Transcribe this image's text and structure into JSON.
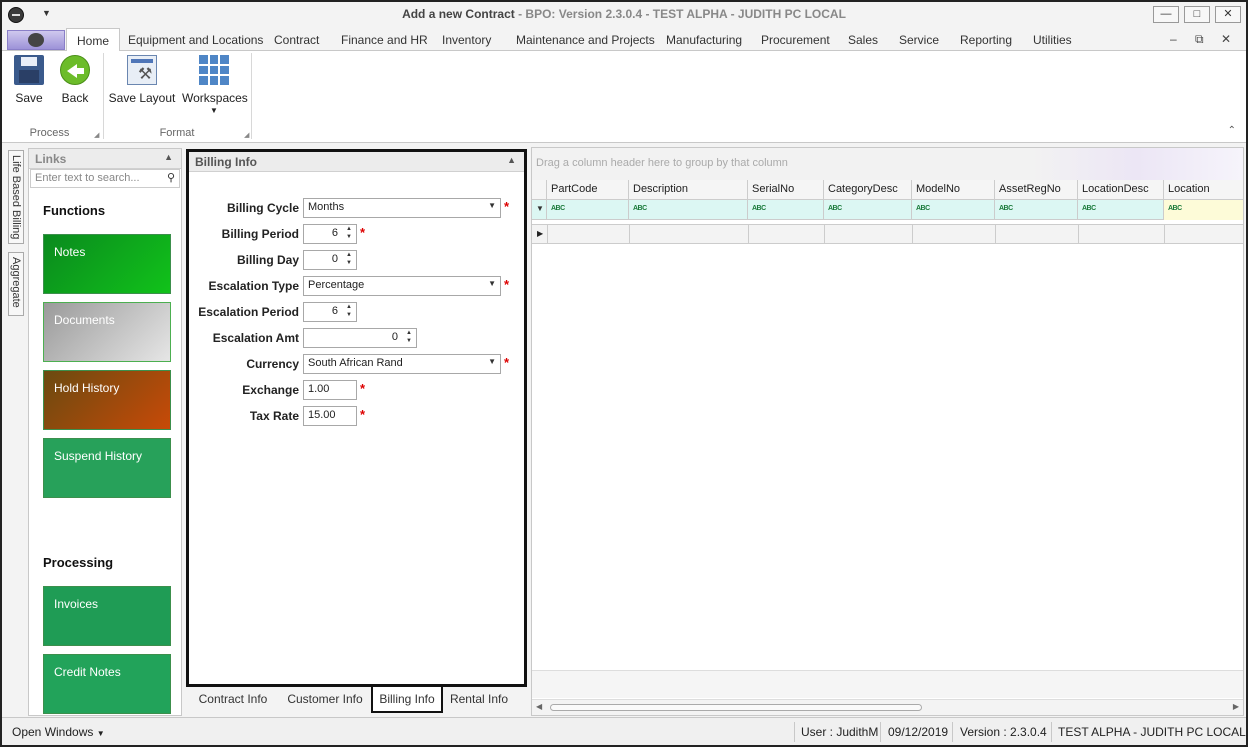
{
  "window": {
    "title": "Add a new Contract",
    "subtitle": "- BPO: Version 2.3.0.4 - TEST ALPHA - JUDITH PC LOCAL",
    "controls": {
      "minimize": "—",
      "maximize": "□",
      "close": "✕"
    }
  },
  "ribbon": {
    "tabs": [
      "Home",
      "Equipment and Locations",
      "Contract",
      "Finance and HR",
      "Inventory",
      "Maintenance and Projects",
      "Manufacturing",
      "Procurement",
      "Sales",
      "Service",
      "Reporting",
      "Utilities"
    ],
    "active_tab": "Home",
    "groups": {
      "process": {
        "label": "Process",
        "save": "Save",
        "back": "Back"
      },
      "format": {
        "label": "Format",
        "save_layout": "Save Layout",
        "workspaces": "Workspaces"
      }
    },
    "mdi": {
      "minimize": "–",
      "restore": "⧉",
      "close": "✕"
    }
  },
  "side_tabs": [
    "Life Based Billing",
    "Aggregate"
  ],
  "links": {
    "title": "Links",
    "search_placeholder": "Enter text to search...",
    "functions_title": "Functions",
    "functions": [
      "Notes",
      "Documents",
      "Hold History",
      "Suspend History"
    ],
    "processing_title": "Processing",
    "processing": [
      "Invoices",
      "Credit Notes"
    ]
  },
  "billing": {
    "title": "Billing Info",
    "fields": {
      "billing_cycle": {
        "label": "Billing Cycle",
        "value": "Months"
      },
      "billing_period": {
        "label": "Billing Period",
        "value": "6"
      },
      "billing_day": {
        "label": "Billing Day",
        "value": "0"
      },
      "escalation_type": {
        "label": "Escalation Type",
        "value": "Percentage"
      },
      "escalation_period": {
        "label": "Escalation Period",
        "value": "6"
      },
      "escalation_amt": {
        "label": "Escalation Amt",
        "value": "0"
      },
      "currency": {
        "label": "Currency",
        "value": "South African Rand"
      },
      "exchange": {
        "label": "Exchange",
        "value": "1.00"
      },
      "tax_rate": {
        "label": "Tax Rate",
        "value": "15.00"
      }
    },
    "required_marker": "*"
  },
  "bottom_tabs": [
    "Contract Info",
    "Customer Info",
    "Billing Info",
    "Rental Info"
  ],
  "active_bottom_tab": "Billing Info",
  "grid": {
    "group_hint": "Drag a column header here to group by that column",
    "columns": [
      "PartCode",
      "Description",
      "SerialNo",
      "CategoryDesc",
      "ModelNo",
      "AssetRegNo",
      "LocationDesc",
      "Location"
    ],
    "filter_glyph": "ABC"
  },
  "status": {
    "open_windows": "Open Windows",
    "user": "User : JudithM",
    "date": "09/12/2019",
    "version": "Version : 2.3.0.4",
    "environment": "TEST ALPHA - JUDITH PC LOCAL"
  }
}
